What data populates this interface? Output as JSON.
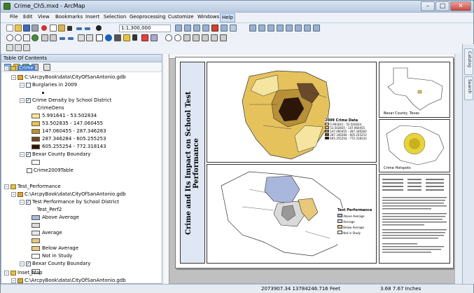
{
  "window": {
    "title": "Crime_Ch5.mxd - ArcMap",
    "buttons": {
      "minimize": "–",
      "maximize": "□",
      "close": "✕"
    }
  },
  "menu": [
    "File",
    "Edit",
    "View",
    "Bookmarks",
    "Insert",
    "Selection",
    "Geoprocessing",
    "Customize",
    "Windows",
    "Help"
  ],
  "toolbar": {
    "scale": "1:1,300,000"
  },
  "toc": {
    "header": "Table Of Contents",
    "frames": [
      {
        "name": "Crime",
        "workspace": "C:\\ArcpyBook\\data\\CityOfSanAntonio.gdb",
        "layers": [
          {
            "name": "Burglaries in 2009"
          },
          {
            "name": "Crime Density by School District",
            "field": "CrimeDens",
            "classes": [
              "5.991641 - 53.502834",
              "53.502835 - 147.060455",
              "147.060455 - 287.346283",
              "287.346284 - 605.255253",
              "605.255254 - 772.318143"
            ]
          },
          {
            "name": "Bexar County Boundary"
          },
          {
            "name": "Crime2009Table"
          }
        ]
      },
      {
        "name": "Test_Performance",
        "workspace": "C:\\ArcpyBook\\data\\CityOfSanAntonio.gdb",
        "layers": [
          {
            "name": "Test Performance by School District",
            "field": "Test_Perf2",
            "classes": [
              "Above Average",
              "Average",
              "Below Average",
              "Not in Study"
            ]
          },
          {
            "name": "Bexar County Boundary"
          }
        ]
      },
      {
        "name": "Inset_Map",
        "workspace": "C:\\ArcpyBook\\data\\CityOfSanAntonio.gdb"
      }
    ]
  },
  "layout": {
    "title": "Crime and Its Impact on School Test Performance",
    "crime_legend_title": "2009 Crime Data",
    "crime_legend": [
      "5.991641 - 53.502834",
      "53.502835 - 147.060455",
      "147.060455 - 287.346283",
      "287.346284 - 605.255253",
      "605.255254 - 772.318143"
    ],
    "test_legend_title": "Test Performance",
    "test_legend": [
      "Above Average",
      "Average",
      "Below Average",
      "Not in Study"
    ],
    "inset_caption": "Bexar County, Texas",
    "hotspot_caption": "Crime Hotspots"
  },
  "colors": {
    "class1": "#f5e5a0",
    "class2": "#e6c25c",
    "class3": "#b79038",
    "class4": "#6b4a2a",
    "class5": "#2b1608",
    "above": "#a9b7dc",
    "average": "#d9d9d9",
    "below": "#e8c87a",
    "notinstudy": "#ffffff"
  },
  "status": {
    "coords": "2073907.34  13784246.716 Feet",
    "page": "3.68  7.67 Inches"
  },
  "dock": {
    "catalog": "Catalog",
    "search": "Search"
  }
}
